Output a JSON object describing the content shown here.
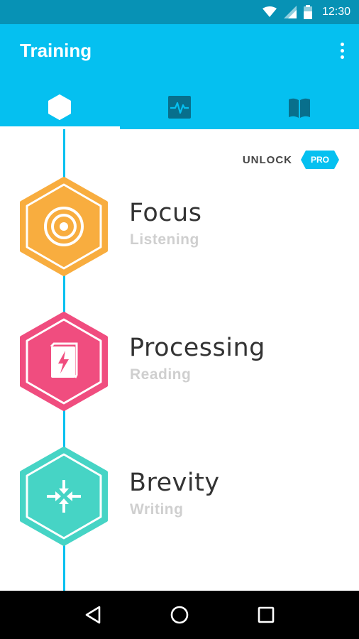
{
  "status_bar": {
    "time": "12:30"
  },
  "app_bar": {
    "title": "Training",
    "tabs": [
      {
        "id": "training",
        "icon": "hexagon-icon",
        "active": true
      },
      {
        "id": "progress",
        "icon": "pulse-chart-icon",
        "active": false
      },
      {
        "id": "library",
        "icon": "book-icon",
        "active": false
      }
    ]
  },
  "unlock": {
    "label": "UNLOCK",
    "badge": "PRO"
  },
  "modules": [
    {
      "title": "Focus",
      "subtitle": "Listening",
      "icon": "target-icon",
      "color": "#f8ad3f"
    },
    {
      "title": "Processing",
      "subtitle": "Reading",
      "icon": "book-lightning-icon",
      "color": "#f04d7f"
    },
    {
      "title": "Brevity",
      "subtitle": "Writing",
      "icon": "compress-arrows-icon",
      "color": "#46d4c5"
    }
  ],
  "colors": {
    "accent": "#05c0f0",
    "status_bar": "#0792b5"
  }
}
